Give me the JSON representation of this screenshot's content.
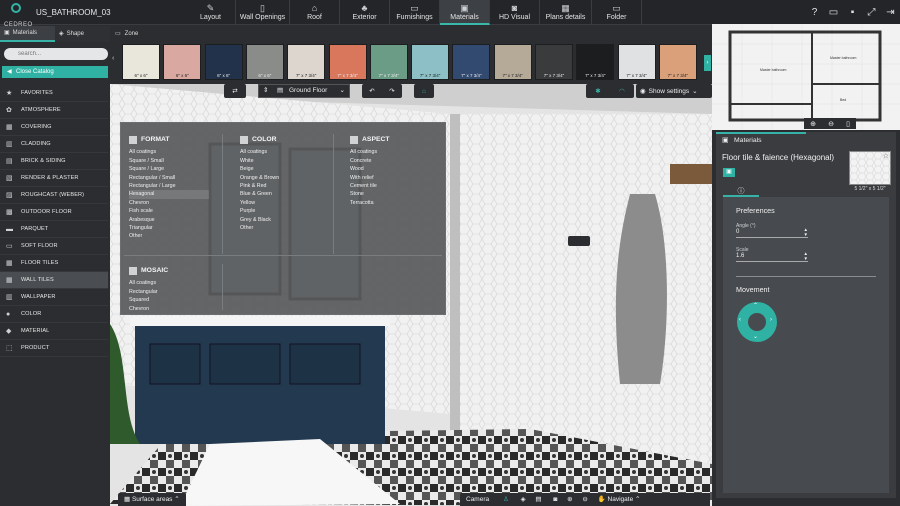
{
  "app": {
    "logo_text": "CEDREO",
    "project_name": "US_BATHROOM_03"
  },
  "nav": [
    {
      "label": "Layout",
      "icon": "pencil-icon",
      "glyph": "✎"
    },
    {
      "label": "Wall Openings",
      "icon": "door-icon",
      "glyph": "▯"
    },
    {
      "label": "Roof",
      "icon": "roof-icon",
      "glyph": "⌂"
    },
    {
      "label": "Exterior",
      "icon": "tree-icon",
      "glyph": "♣"
    },
    {
      "label": "Furnishings",
      "icon": "sofa-icon",
      "glyph": "▭"
    },
    {
      "label": "Materials",
      "icon": "paint-roller-icon",
      "glyph": "▣"
    },
    {
      "label": "HD Visual",
      "icon": "camera-icon",
      "glyph": "◙"
    },
    {
      "label": "Plans details",
      "icon": "plans-icon",
      "glyph": "▦"
    },
    {
      "label": "Folder",
      "icon": "folder-icon",
      "glyph": "▭"
    }
  ],
  "top_icons": [
    {
      "name": "help-icon",
      "glyph": "?"
    },
    {
      "name": "comment-icon",
      "glyph": "▭"
    },
    {
      "name": "save-icon",
      "glyph": "▪"
    },
    {
      "name": "fullscreen-icon",
      "glyph": "⤢"
    },
    {
      "name": "exit-icon",
      "glyph": "⇥"
    }
  ],
  "side_tabs": {
    "materials": "Materials",
    "shape": "Shape",
    "zone": "Zone"
  },
  "search": {
    "placeholder": "search..."
  },
  "close_catalog": "Close Catalog",
  "categories": [
    "FAVORITES",
    "ATMOSPHERE",
    "COVERING",
    "CLADDING",
    "BRICK & SIDING",
    "RENDER & PLASTER",
    "ROUGHCAST (WEBER)",
    "OUTDOOR FLOOR",
    "PARQUET",
    "SOFT FLOOR",
    "FLOOR TILES",
    "WALL TILES",
    "WALLPAPER",
    "COLOR",
    "MATERIAL",
    "PRODUCT"
  ],
  "active_category": "WALL TILES",
  "swatches": [
    {
      "label": "6\" x 6\"",
      "color": "#e9e6dc"
    },
    {
      "label": "6\" x 6\"",
      "color": "#d9a8a0"
    },
    {
      "label": "6\" x 6\"",
      "color": "#22324a"
    },
    {
      "label": "6\" x 6\"",
      "color": "#8a8c8a"
    },
    {
      "label": "7\" x 7 3/4\"",
      "color": "#ddd6cf"
    },
    {
      "label": "7\" x 7 3/4\"",
      "color": "#d9775c"
    },
    {
      "label": "7\" x 7 3/4\"",
      "color": "#6a9c86"
    },
    {
      "label": "7\" x 7 3/4\"",
      "color": "#8cc0c6"
    },
    {
      "label": "7\" x 7 3/4\"",
      "color": "#324a70"
    },
    {
      "label": "7\" x 7 3/4\"",
      "color": "#b5aa98"
    },
    {
      "label": "7\" x 7 3/4\"",
      "color": "#3a3b3d"
    },
    {
      "label": "7\" x 7 3/4\"",
      "color": "#1c1d1e"
    },
    {
      "label": "7\" x 7 3/4\"",
      "color": "#dfe1e2"
    },
    {
      "label": "7\" x 7 3/4\"",
      "color": "#d9a07a"
    }
  ],
  "viewport": {
    "floor": "Ground Floor",
    "show_settings": "Show settings",
    "surface_areas": "Surface areas",
    "camera": "Camera",
    "navigate": "Navigate"
  },
  "filter_popup": {
    "format": {
      "title": "FORMAT",
      "items": [
        "All coatings",
        "Square / Small",
        "Square / Large",
        "Rectangular / Small",
        "Rectangular / Large",
        "Hexagonal",
        "Chevron",
        "Fish scale",
        "Arabesque",
        "Triangular",
        "Other"
      ],
      "selected": "Hexagonal"
    },
    "color": {
      "title": "COLOR",
      "items": [
        "All coatings",
        "White",
        "Beige",
        "Orange & Brown",
        "Pink & Red",
        "Blue & Green",
        "Yellow",
        "Purple",
        "Grey & Black",
        "Other"
      ]
    },
    "aspect": {
      "title": "ASPECT",
      "items": [
        "All coatings",
        "Concrete",
        "Wood",
        "With relief",
        "Cement tile",
        "Stone",
        "Terracotta"
      ]
    },
    "mosaic": {
      "title": "MOSAIC",
      "items": [
        "All coatings",
        "Rectangular",
        "Squared",
        "Chevron"
      ]
    }
  },
  "materials_panel": {
    "tab": "Materials",
    "title": "Floor tile & faience (Hexagonal)",
    "size": "5 1/2\" x 5 1/2\"",
    "preferences": "Preferences",
    "angle_label": "Angle (°)",
    "angle_value": "0",
    "scale_label": "Scale",
    "scale_value": "1.6",
    "movement": "Movement"
  },
  "minimap": {
    "room1": "Master bathroom",
    "room2": "Master bathroom",
    "room3": "Bed"
  }
}
